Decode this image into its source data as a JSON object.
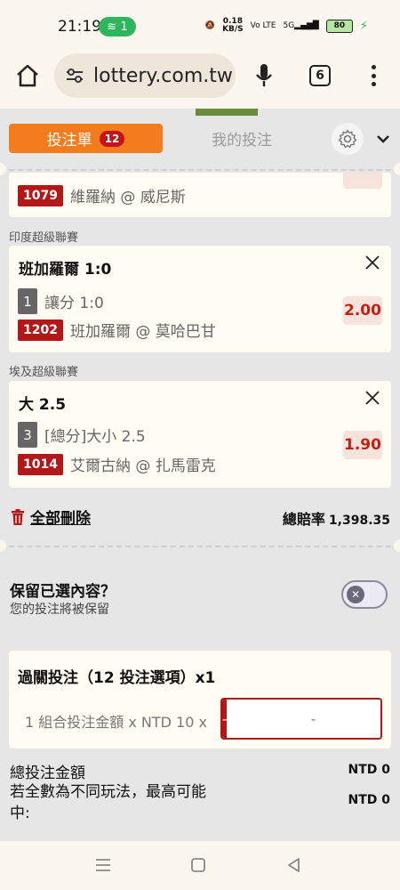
{
  "status_bar": {
    "time": "21:19",
    "hotspot_count": "1",
    "speed_value": "0.18",
    "speed_unit": "KB/S",
    "battery": "80"
  },
  "browser": {
    "url": "lottery.com.tw",
    "tab_count": "6"
  },
  "bet_slip": {
    "tab_label": "投注單",
    "tab_count": "12",
    "my_bets_label": "我的投注",
    "partial_card": {
      "code": "1079",
      "match": "維羅納 @ 威尼斯"
    },
    "selections": [
      {
        "league": "印度超級聯賽",
        "title": "班加羅爾 1:0",
        "num": "1",
        "market": "讓分 1:0",
        "code": "1202",
        "match": "班加羅爾 @ 莫哈巴甘",
        "odds": "2.00"
      },
      {
        "league": "埃及超級聯賽",
        "title": "大 2.5",
        "num": "3",
        "market": "[總分]大小 2.5",
        "code": "1014",
        "match": "艾爾古納 @ 扎馬雷克",
        "odds": "1.90"
      }
    ],
    "delete_all_label": "全部刪除",
    "total_odds_label": "總賠率",
    "total_odds_value": "1,398.35",
    "keep_title": "保留已選內容？",
    "keep_subtitle": "您的投注將被保留",
    "parlay_title": "過關投注（12 投注選項）x1",
    "stake_label": "1 組合投注金額 x NTD 10 x",
    "minus_label": "-",
    "plus_label": "+",
    "stake_placeholder": "-",
    "total_stake_label": "總投注金額",
    "total_stake_value": "NTD 0",
    "max_win_label": "若全數為不同玩法，最高可能中:",
    "max_win_value": "NTD 0"
  },
  "colors": {
    "accent_orange": "#f47c1d",
    "brand_red": "#b31718",
    "odds_red": "#c02216"
  }
}
